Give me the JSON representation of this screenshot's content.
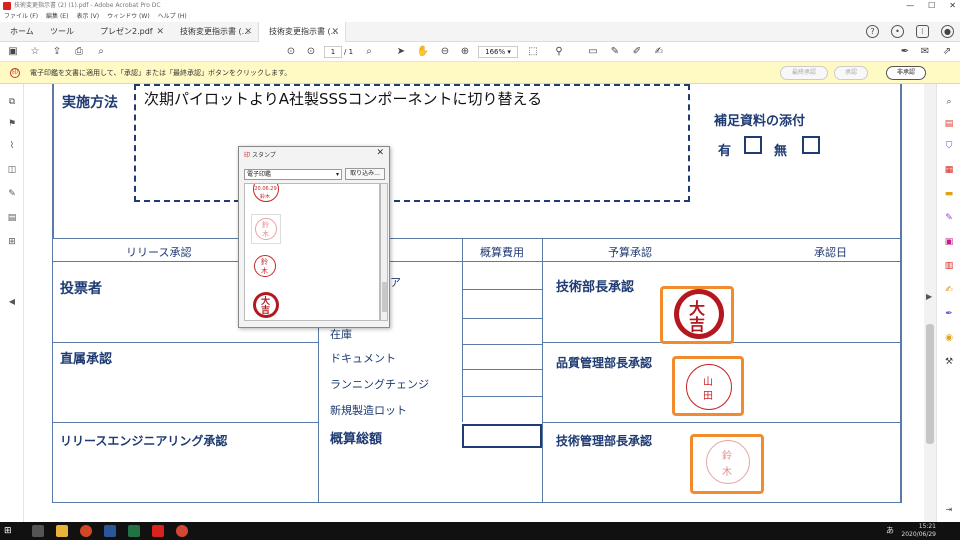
{
  "window": {
    "title": "技術変更指示書 (2) (1).pdf - Adobe Acrobat Pro DC",
    "controls": [
      "—",
      "☐",
      "✕"
    ]
  },
  "menu": [
    "ファイル (F)",
    "編集 (E)",
    "表示 (V)",
    "ウィンドウ (W)",
    "ヘルプ (H)"
  ],
  "tabs": [
    {
      "label": "ホーム"
    },
    {
      "label": "ツール"
    },
    {
      "label": "プレゼン2.pdf"
    },
    {
      "label": "技術変更指示書 (..."
    },
    {
      "label": "技術変更指示書 (..."
    }
  ],
  "toolbar": {
    "page_current": "1",
    "page_total": "/ 1",
    "zoom": "166%"
  },
  "notice": {
    "message": "電子印鑑を文書に適用して、「承認」または「最終承認」ボタンをクリックします。",
    "btn_final": "最終承認",
    "btn_approve": "承認",
    "btn_reject": "非承認"
  },
  "document": {
    "method_label": "実施方法",
    "method_text": "次期パイロットよりA社製SSSコンポーネントに切り替える",
    "attach_label": "補足資料の添付",
    "attach_yes": "有",
    "attach_no": "無",
    "release_approval": "リリース承認",
    "cost_header": "概算費用",
    "budget_approval": "予算承認",
    "approval_date": "承認日",
    "submitter": "投票者",
    "direct_approval": "直属承認",
    "release_eng": "リリースエンジニアリング承認",
    "item_fragment": "ア",
    "items": [
      "在庫",
      "ドキュメント",
      "ランニングチェンジ",
      "新規製造ロット"
    ],
    "cost_total": "概算総額",
    "tech_manager": "技術部長承認",
    "qc_manager": "品質管理部長承認",
    "tm_manager": "技術管理部長承認",
    "hanko1": [
      "大",
      "吉"
    ],
    "hanko2": [
      "山",
      "田"
    ],
    "hanko3": [
      "鈴",
      "木"
    ]
  },
  "stamp_palette": {
    "title": "スタンプ",
    "category": "電子印鑑",
    "import_label": "取り込み...",
    "stamps": [
      {
        "top": "経",
        "date": "'20.06.29",
        "bottom": "鈴木"
      },
      {
        "top": "鈴",
        "bottom": "木"
      },
      {
        "top": "鈴",
        "bottom": "木"
      },
      {
        "top": "大",
        "bottom": "吉"
      }
    ]
  },
  "taskbar": {
    "ime": "あ",
    "time": "15:21",
    "date": "2020/06/29"
  }
}
